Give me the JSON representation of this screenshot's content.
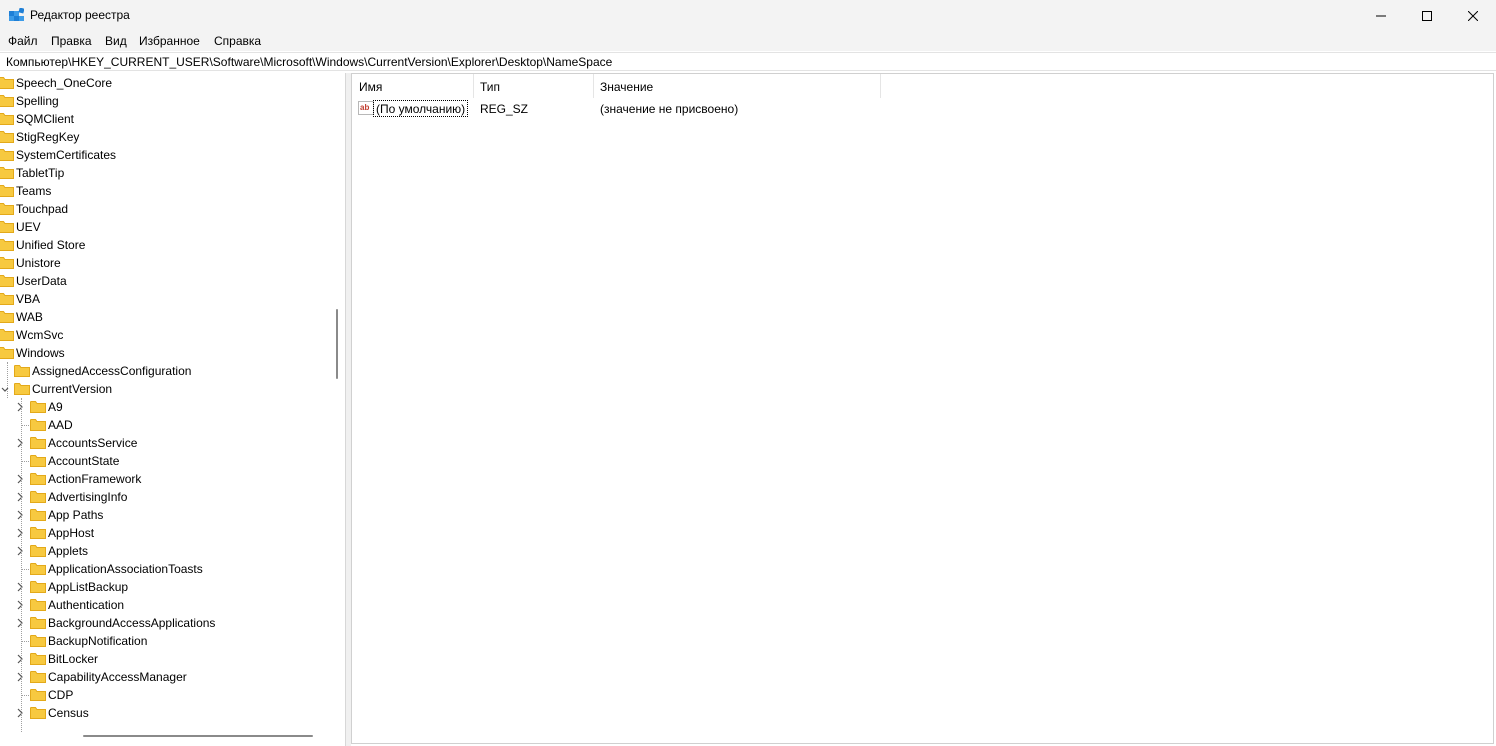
{
  "window": {
    "title": "Редактор реестра"
  },
  "menu": [
    "Файл",
    "Правка",
    "Вид",
    "Избранное",
    "Справка"
  ],
  "address": "Компьютер\\HKEY_CURRENT_USER\\Software\\Microsoft\\Windows\\CurrentVersion\\Explorer\\Desktop\\NameSpace",
  "tree": {
    "level1": [
      "Speech_OneCore",
      "Spelling",
      "SQMClient",
      "StigRegKey",
      "SystemCertificates",
      "TabletTip",
      "Teams",
      "Touchpad",
      "UEV",
      "Unified Store",
      "Unistore",
      "UserData",
      "VBA",
      "WAB",
      "WcmSvc",
      "Windows"
    ],
    "level2": [
      "AssignedAccessConfiguration",
      "CurrentVersion"
    ],
    "level3": [
      {
        "label": "A9",
        "expandable": true
      },
      {
        "label": "AAD",
        "expandable": false
      },
      {
        "label": "AccountsService",
        "expandable": true
      },
      {
        "label": "AccountState",
        "expandable": false
      },
      {
        "label": "ActionFramework",
        "expandable": true
      },
      {
        "label": "AdvertisingInfo",
        "expandable": true
      },
      {
        "label": "App Paths",
        "expandable": true
      },
      {
        "label": "AppHost",
        "expandable": true
      },
      {
        "label": "Applets",
        "expandable": true
      },
      {
        "label": "ApplicationAssociationToasts",
        "expandable": false
      },
      {
        "label": "AppListBackup",
        "expandable": true
      },
      {
        "label": "Authentication",
        "expandable": true
      },
      {
        "label": "BackgroundAccessApplications",
        "expandable": true
      },
      {
        "label": "BackupNotification",
        "expandable": false
      },
      {
        "label": "BitLocker",
        "expandable": true
      },
      {
        "label": "CapabilityAccessManager",
        "expandable": true
      },
      {
        "label": "CDP",
        "expandable": false
      },
      {
        "label": "Census",
        "expandable": true
      }
    ]
  },
  "list": {
    "columns": [
      "Имя",
      "Тип",
      "Значение"
    ],
    "rows": [
      {
        "name": "(По умолчанию)",
        "type": "REG_SZ",
        "value": "(значение не присвоено)"
      }
    ]
  },
  "colors": {
    "folder": "#f7c940",
    "folder_dark": "#e3a91a",
    "chrome": "#f3f3f3",
    "regsz_icon": "#c0392b"
  }
}
